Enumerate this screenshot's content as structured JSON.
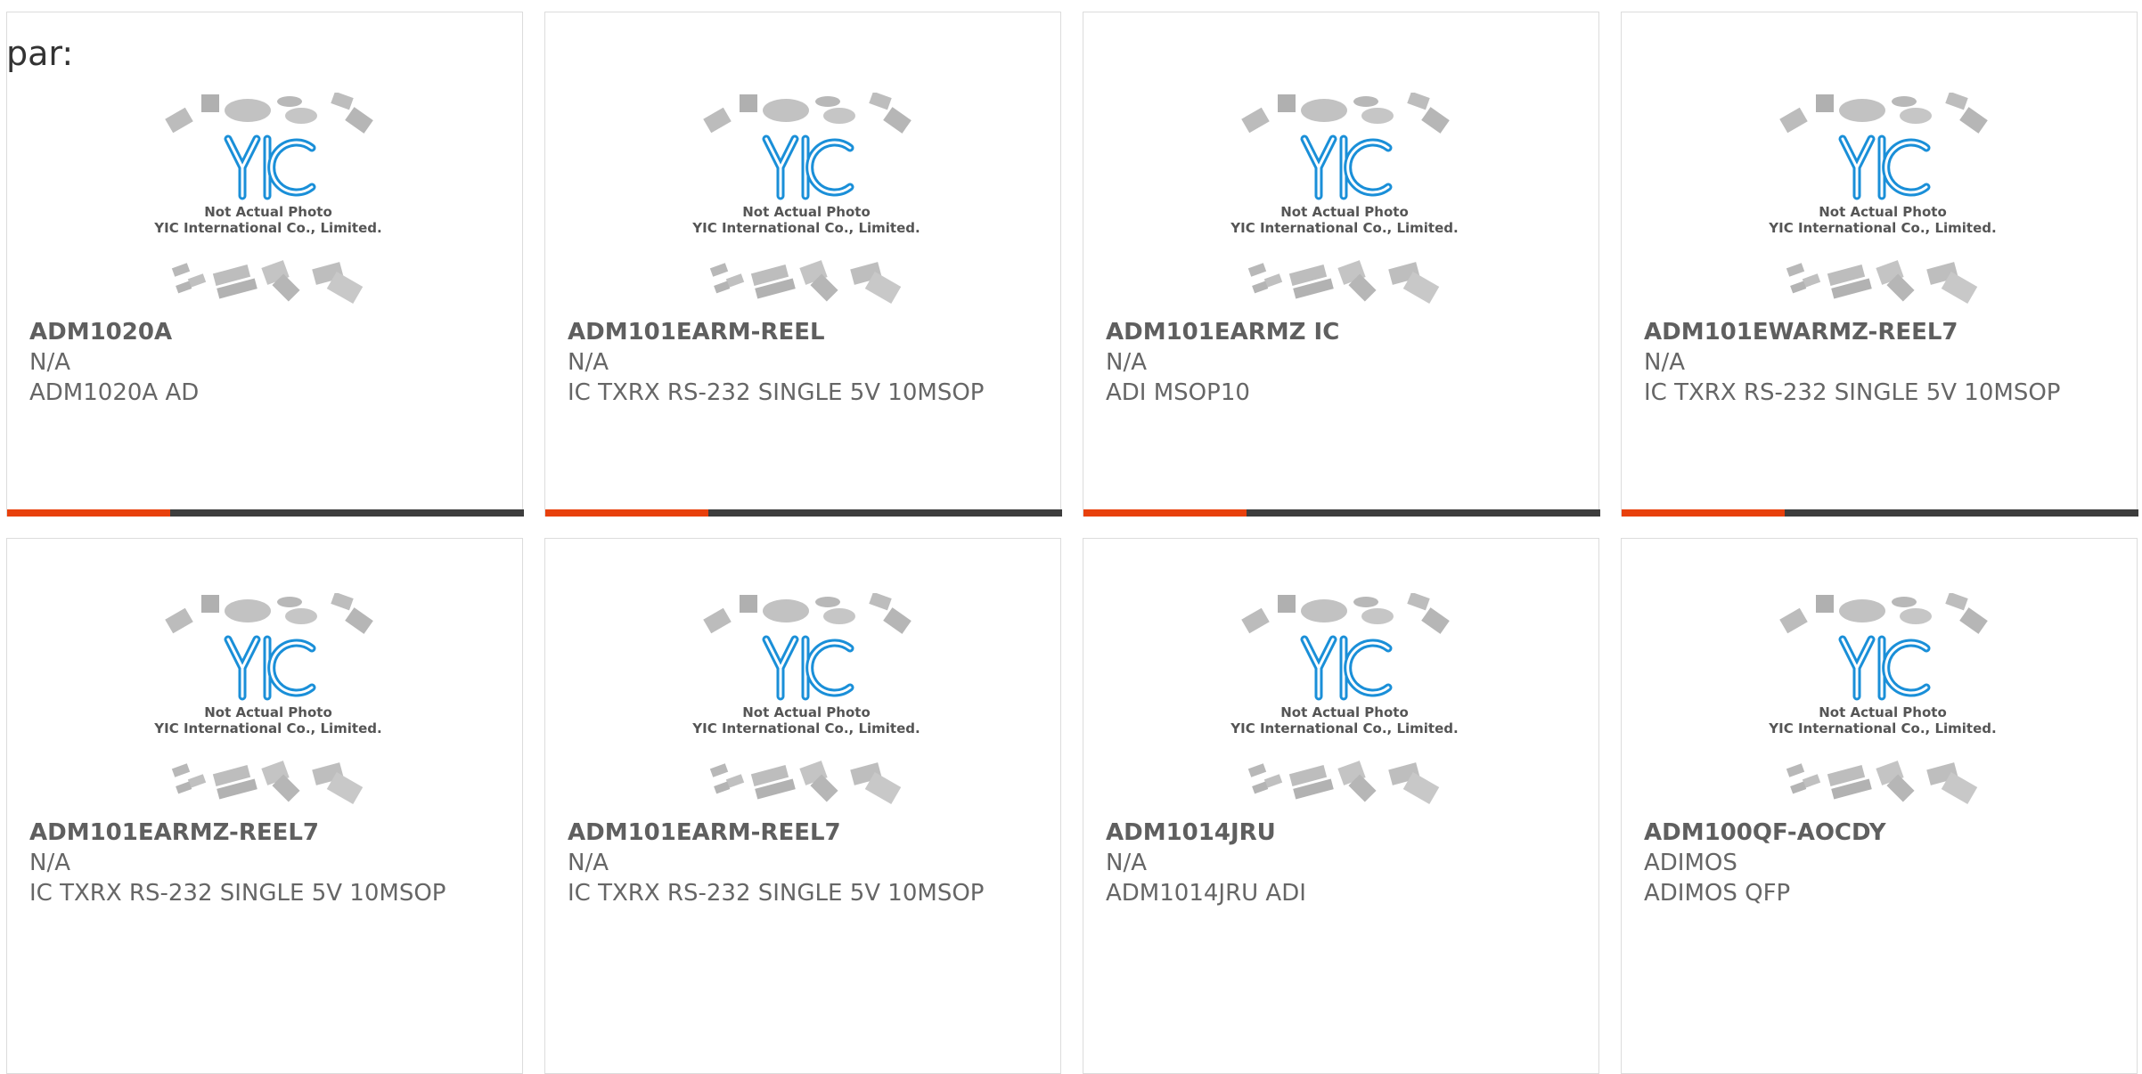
{
  "prefix_label": "par:",
  "photo": {
    "line1": "Not Actual Photo",
    "line2": "YIC International Co., Limited.",
    "logo": "YIC"
  },
  "colors": {
    "accent": "#e8400c",
    "bar": "#3d3d3d",
    "logo_blue": "#1a8fd8",
    "text": "#666666"
  },
  "products": [
    {
      "part": "ADM1020A",
      "brand": "N/A",
      "desc": "ADM1020A AD"
    },
    {
      "part": "ADM101EARM-REEL",
      "brand": "N/A",
      "desc": "IC TXRX RS-232 SINGLE 5V 10MSOP"
    },
    {
      "part": "ADM101EARMZ IC",
      "brand": "N/A",
      "desc": "ADI MSOP10"
    },
    {
      "part": "ADM101EWARMZ-REEL7",
      "brand": "N/A",
      "desc": "IC TXRX RS-232 SINGLE 5V 10MSOP"
    },
    {
      "part": "ADM101EARMZ-REEL7",
      "brand": "N/A",
      "desc": "IC TXRX RS-232 SINGLE 5V 10MSOP"
    },
    {
      "part": "ADM101EARM-REEL7",
      "brand": "N/A",
      "desc": "IC TXRX RS-232 SINGLE 5V 10MSOP"
    },
    {
      "part": "ADM1014JRU",
      "brand": "N/A",
      "desc": "ADM1014JRU ADI"
    },
    {
      "part": "ADM100QF-AOCDY",
      "brand": "ADIMOS",
      "desc": "ADIMOS QFP"
    }
  ]
}
